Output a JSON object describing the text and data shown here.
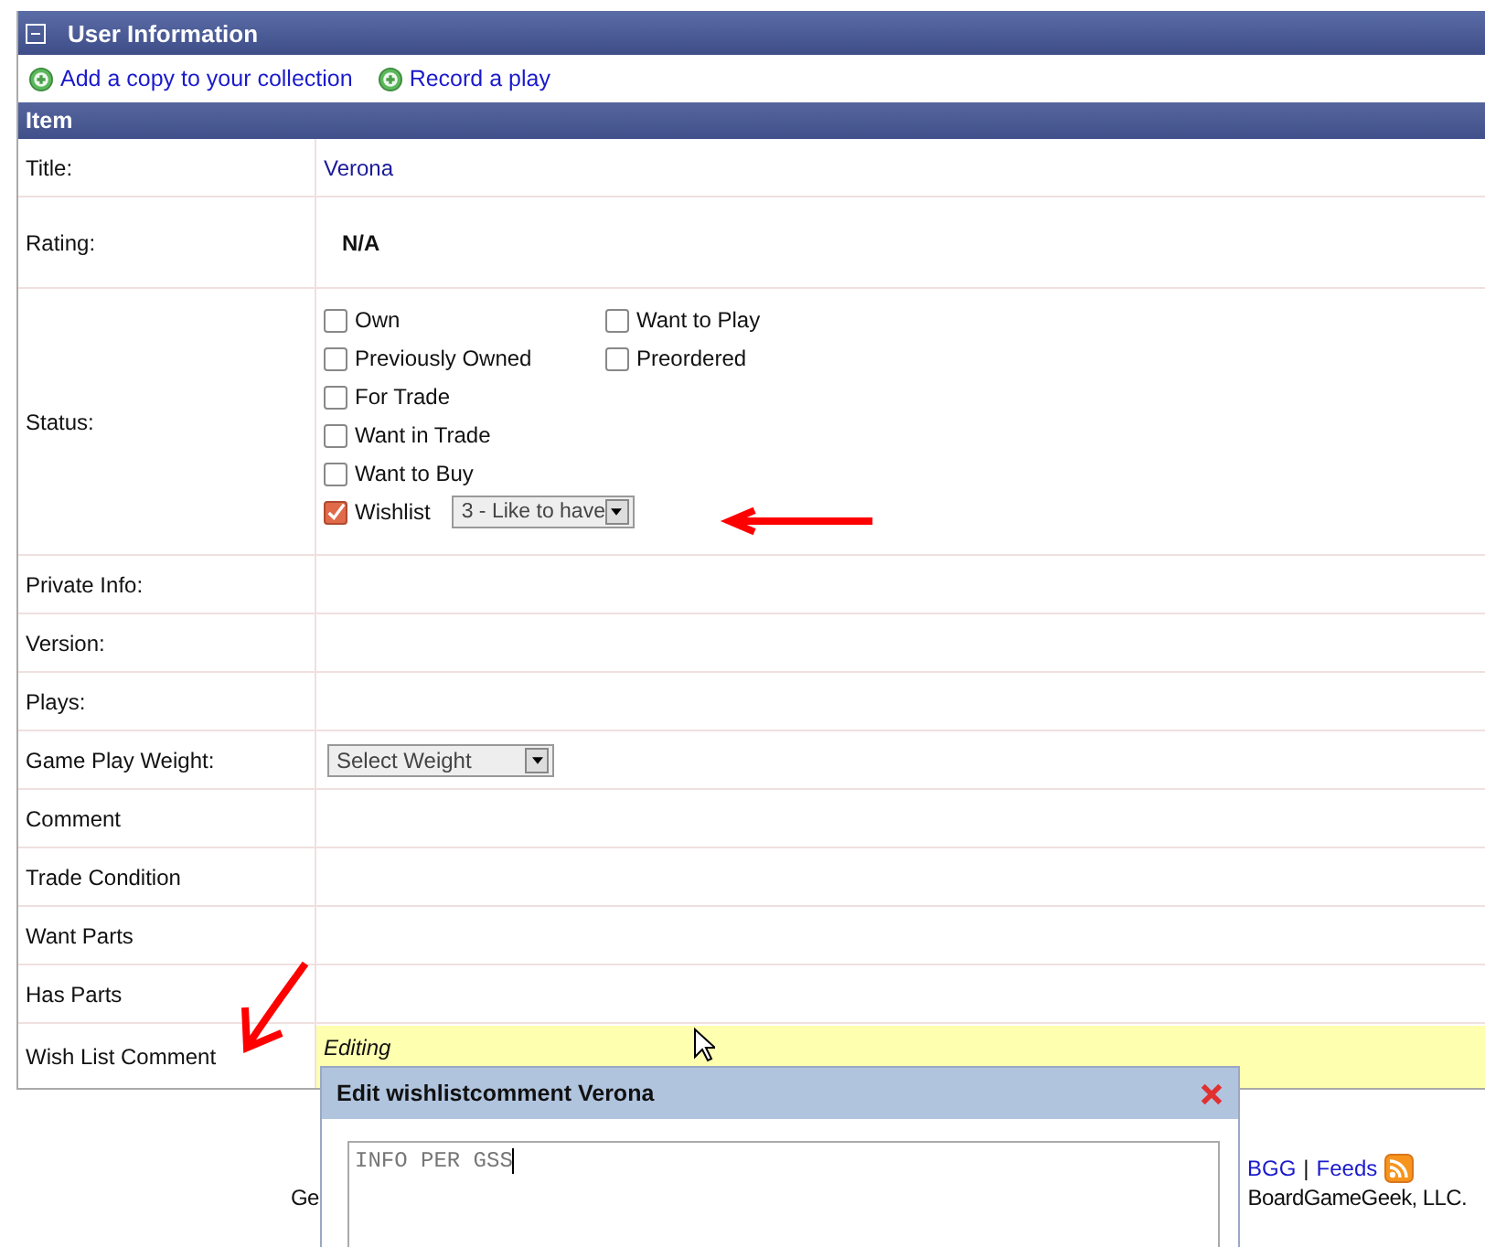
{
  "panel": {
    "title": "User Information",
    "collapsed": false
  },
  "actions": [
    "Add a copy to your collection",
    "Record a play"
  ],
  "section": "Item",
  "rows": [
    {
      "label": "Title:",
      "kind": "link",
      "value": "Verona"
    },
    {
      "label": "Rating:",
      "kind": "bold",
      "value": "N/A"
    },
    {
      "label": "Status:",
      "kind": "status"
    },
    {
      "label": "Private Info:",
      "kind": "empty"
    },
    {
      "label": "Version:",
      "kind": "empty"
    },
    {
      "label": "Plays:",
      "kind": "empty"
    },
    {
      "label": "Game Play Weight:",
      "kind": "select",
      "value": "Select Weight"
    },
    {
      "label": "Comment",
      "kind": "empty"
    },
    {
      "label": "Trade Condition",
      "kind": "empty"
    },
    {
      "label": "Want Parts",
      "kind": "empty"
    },
    {
      "label": "Has Parts",
      "kind": "empty"
    },
    {
      "label": "Wish List Comment",
      "kind": "editing",
      "value": "Editing"
    }
  ],
  "status": {
    "left": [
      {
        "label": "Own",
        "checked": false
      },
      {
        "label": "Previously Owned",
        "checked": false
      },
      {
        "label": "For Trade",
        "checked": false
      },
      {
        "label": "Want in Trade",
        "checked": false
      },
      {
        "label": "Want to Buy",
        "checked": false
      },
      {
        "label": "Wishlist",
        "checked": true,
        "select": "3 - Like to have"
      }
    ],
    "right": [
      {
        "label": "Want to Play",
        "checked": false
      },
      {
        "label": "Preordered",
        "checked": false
      }
    ]
  },
  "footer": {
    "line_1": [
      "BGG",
      "|",
      "Feeds"
    ],
    "line_2": [
      "Ge",
      "BoardGameGeek, LLC."
    ]
  },
  "dialog": {
    "title": "Edit wishlistcomment Verona",
    "value": "INFO PER GSS"
  }
}
